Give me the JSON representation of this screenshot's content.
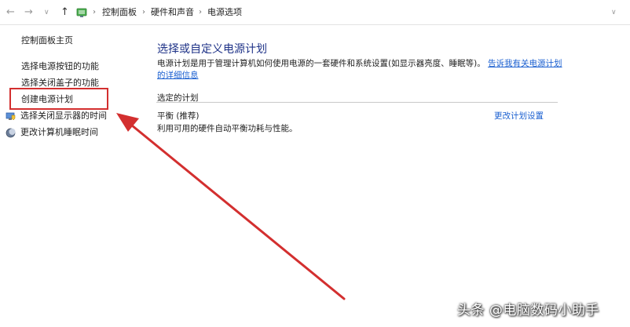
{
  "address_bar": {
    "back_icon": "back-arrow-icon",
    "forward_icon": "forward-arrow-icon",
    "recent_icon": "chevron-down-icon",
    "up_icon": "up-arrow-icon",
    "location_icon": "control-panel-icon",
    "breadcrumbs": [
      "控制面板",
      "硬件和声音",
      "电源选项"
    ],
    "dropdown_icon": "chevron-down-icon",
    "refresh_icon": "refresh-icon"
  },
  "sidebar": {
    "home_label": "控制面板主页",
    "items": [
      {
        "label": "选择电源按钮的功能"
      },
      {
        "label": "选择关闭盖子的功能"
      },
      {
        "label": "创建电源计划"
      },
      {
        "label": "选择关闭显示器的时间",
        "icon": "monitor-shield-icon"
      },
      {
        "label": "更改计算机睡眠时间",
        "icon": "sleep-moon-icon"
      }
    ]
  },
  "main": {
    "title": "选择或自定义电源计划",
    "description": "电源计划是用于管理计算机如何使用电源的一套硬件和系统设置(如显示器亮度、睡眠等)。",
    "description_link": "告诉我有关电源计划的详细信息",
    "section_label": "选定的计划",
    "plan": {
      "name": "平衡 (推荐)",
      "description": "利用可用的硬件自动平衡功耗与性能。",
      "change_link": "更改计划设置"
    }
  },
  "annotation": {
    "highlight_color": "#d32f2f",
    "arrow_color": "#d32f2f"
  },
  "watermark": "头条 @电脑数码小助手"
}
